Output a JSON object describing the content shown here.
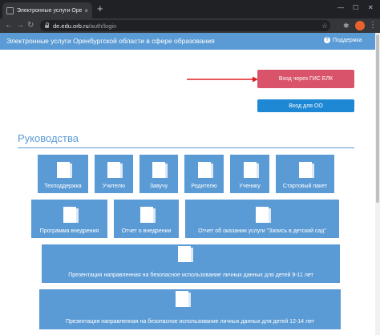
{
  "browser": {
    "tab_title": "Электронные услуги Оренбургск",
    "tab_close": "×",
    "new_tab": "+",
    "window_controls": {
      "minimize": "—",
      "maximize": "☐",
      "close": "✕"
    },
    "url_host": "de.edu.orb.ru",
    "url_path": "/auth/login",
    "nav": {
      "back": "←",
      "forward": "→",
      "reload": "↻"
    },
    "toolbar_icons": [
      "star-icon",
      "puzzle-icon",
      "profile-avatar",
      "menu-icon"
    ],
    "star": "☆",
    "puzzle": "✱",
    "menu": "⋮"
  },
  "header": {
    "title": "Электронные услуги Оренбургской области в сфере образования",
    "support": "Поддержка",
    "help_glyph": "?",
    "color": "#5b9bd5"
  },
  "auth": {
    "esia_button": "Вход через ГИС ЕЛК",
    "oo_button": "Вход для ОО",
    "esia_color": "#d9546a",
    "oo_color": "#1e88d5",
    "arrow_color": "#e02020"
  },
  "guides": {
    "title": "Руководства",
    "row1": [
      "Техподдержка",
      "Учителю",
      "Завучу",
      "Родителю",
      "Ученику",
      "Стартовый пакет"
    ],
    "row2": [
      "Программа внедрения",
      "Отчет о внедрении",
      "Отчет об оказании услуги \"Запись в детский сад\""
    ],
    "wide": [
      "Презентация направленная на безопасное использование личных данных для детей 9-11 лет",
      "Презентация направленная на безопасное использование личных данных для детей 12-14 лет"
    ]
  }
}
